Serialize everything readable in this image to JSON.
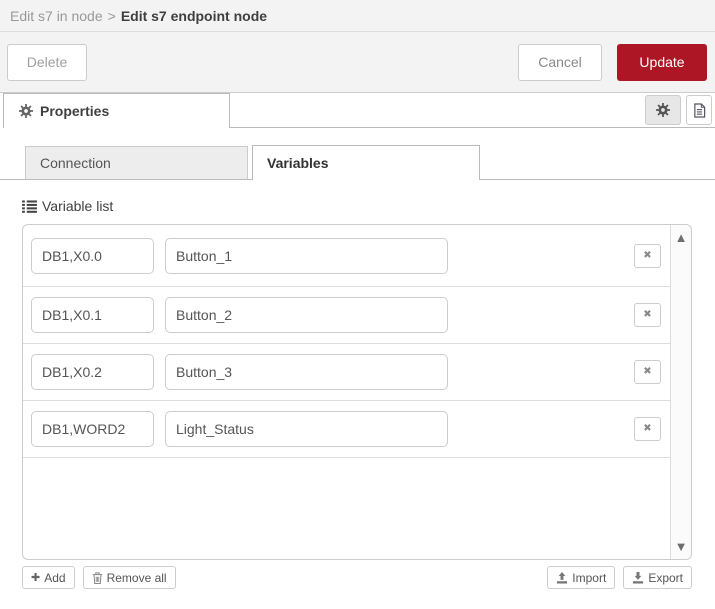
{
  "header": {
    "breadcrumb": {
      "parent": "Edit s7 in node",
      "separator": ">",
      "current": "Edit s7 endpoint node"
    },
    "delete_label": "Delete",
    "cancel_label": "Cancel",
    "update_label": "Update"
  },
  "properties_tab": {
    "label": "Properties"
  },
  "tabs": [
    {
      "label": "Connection",
      "active": false
    },
    {
      "label": "Variables",
      "active": true
    }
  ],
  "variable_list": {
    "label": "Variable list",
    "rows": [
      {
        "address": "DB1,X0.0",
        "name": "Button_1"
      },
      {
        "address": "DB1,X0.1",
        "name": "Button_2"
      },
      {
        "address": "DB1,X0.2",
        "name": "Button_3"
      },
      {
        "address": "DB1,WORD2",
        "name": "Light_Status"
      }
    ],
    "footer": {
      "add_label": "Add",
      "remove_all_label": "Remove all",
      "import_label": "Import",
      "export_label": "Export"
    }
  },
  "glyphs": {
    "row_delete_x": "✖",
    "scroll_up": "▲",
    "scroll_down": "▼",
    "add_plus": "✚"
  },
  "colors": {
    "accent_red": "#AD1625",
    "header_bg": "#f3f3f3"
  }
}
